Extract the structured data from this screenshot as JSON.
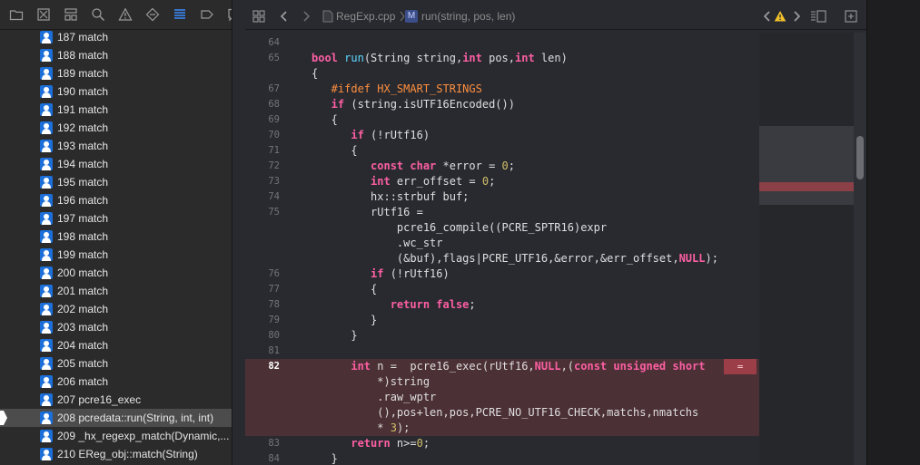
{
  "navigator": {
    "toolbar_icons": [
      "folder-icon",
      "source-control-icon",
      "hierarchy-icon",
      "search-icon",
      "warning-icon",
      "breakpoint-icon",
      "debug-navigator-icon",
      "tag-icon",
      "report-icon"
    ],
    "frames": [
      {
        "label": "187 match",
        "selected": false
      },
      {
        "label": "188 match",
        "selected": false
      },
      {
        "label": "189 match",
        "selected": false
      },
      {
        "label": "190 match",
        "selected": false
      },
      {
        "label": "191 match",
        "selected": false
      },
      {
        "label": "192 match",
        "selected": false
      },
      {
        "label": "193 match",
        "selected": false
      },
      {
        "label": "194 match",
        "selected": false
      },
      {
        "label": "195 match",
        "selected": false
      },
      {
        "label": "196 match",
        "selected": false
      },
      {
        "label": "197 match",
        "selected": false
      },
      {
        "label": "198 match",
        "selected": false
      },
      {
        "label": "199 match",
        "selected": false
      },
      {
        "label": "200 match",
        "selected": false
      },
      {
        "label": "201 match",
        "selected": false
      },
      {
        "label": "202 match",
        "selected": false
      },
      {
        "label": "203 match",
        "selected": false
      },
      {
        "label": "204 match",
        "selected": false
      },
      {
        "label": "205 match",
        "selected": false
      },
      {
        "label": "206 match",
        "selected": false
      },
      {
        "label": "207 pcre16_exec",
        "selected": false
      },
      {
        "label": "208 pcredata::run(String, int, int)",
        "selected": true
      },
      {
        "label": "209 _hx_regexp_match(Dynamic,...",
        "selected": false
      },
      {
        "label": "210 EReg_obj::match(String)",
        "selected": false
      }
    ]
  },
  "jumpbar": {
    "file": "RegExp.cpp",
    "method_badge": "M",
    "method": "run(string, pos, len)"
  },
  "editor": {
    "current_line": "82",
    "error_badge": "=",
    "lines": [
      {
        "n": "64",
        "t": []
      },
      {
        "n": "65",
        "t": [
          [
            "kw",
            "bool "
          ],
          [
            "fn",
            "run"
          ],
          [
            "",
            "(String string,"
          ],
          [
            "kw",
            "int"
          ],
          [
            "",
            " pos,"
          ],
          [
            "kw",
            "int"
          ],
          [
            "",
            " len)"
          ]
        ]
      },
      {
        "n": "",
        "t": [
          [
            "",
            "{"
          ]
        ]
      },
      {
        "n": "67",
        "t": [
          [
            "pp",
            "   #ifdef HX_SMART_STRINGS"
          ]
        ]
      },
      {
        "n": "68",
        "t": [
          [
            "kw",
            "   if"
          ],
          [
            "",
            " (string.isUTF16Encoded())"
          ]
        ]
      },
      {
        "n": "69",
        "t": [
          [
            "",
            "   {"
          ]
        ]
      },
      {
        "n": "70",
        "t": [
          [
            "kw",
            "      if"
          ],
          [
            "",
            " (!rUtf16)"
          ]
        ]
      },
      {
        "n": "71",
        "t": [
          [
            "",
            "      {"
          ]
        ]
      },
      {
        "n": "72",
        "t": [
          [
            "kw",
            "         const char"
          ],
          [
            "",
            " *error = "
          ],
          [
            "num",
            "0"
          ],
          [
            "",
            ";"
          ]
        ]
      },
      {
        "n": "73",
        "t": [
          [
            "kw",
            "         int"
          ],
          [
            "",
            " err_offset = "
          ],
          [
            "num",
            "0"
          ],
          [
            "",
            ";"
          ]
        ]
      },
      {
        "n": "74",
        "t": [
          [
            "",
            "         hx::strbuf buf;"
          ]
        ]
      },
      {
        "n": "75",
        "t": [
          [
            "",
            "         rUtf16 ="
          ]
        ]
      },
      {
        "n": "",
        "t": [
          [
            "",
            "             pcre16_compile((PCRE_SPTR16)expr"
          ]
        ]
      },
      {
        "n": "",
        "t": [
          [
            "",
            "             .wc_str"
          ]
        ]
      },
      {
        "n": "",
        "t": [
          [
            "",
            "             (&buf),flags|PCRE_UTF16,&error,&err_offset,"
          ],
          [
            "kw",
            "NULL"
          ],
          [
            "",
            ");"
          ]
        ]
      },
      {
        "n": "76",
        "t": [
          [
            "kw",
            "         if"
          ],
          [
            "",
            " (!rUtf16)"
          ]
        ]
      },
      {
        "n": "77",
        "t": [
          [
            "",
            "         {"
          ]
        ]
      },
      {
        "n": "78",
        "t": [
          [
            "kw",
            "            return false"
          ],
          [
            "",
            ";"
          ]
        ]
      },
      {
        "n": "79",
        "t": [
          [
            "",
            "         }"
          ]
        ]
      },
      {
        "n": "80",
        "t": [
          [
            "",
            "      }"
          ]
        ]
      },
      {
        "n": "81",
        "t": []
      },
      {
        "n": "82",
        "t": [
          [
            "kw",
            "      int"
          ],
          [
            "",
            " n =  pcre16_exec(rUtf16,"
          ],
          [
            "kw",
            "NULL"
          ],
          [
            "",
            ",("
          ],
          [
            "kw",
            "const unsigned short"
          ]
        ]
      },
      {
        "n": "",
        "t": [
          [
            "",
            "          *)string"
          ]
        ]
      },
      {
        "n": "",
        "t": [
          [
            "",
            "          .raw_wptr"
          ]
        ]
      },
      {
        "n": "",
        "t": [
          [
            "",
            "          (),pos+len,pos,PCRE_NO_UTF16_CHECK,matchs,nmatchs"
          ]
        ]
      },
      {
        "n": "",
        "t": [
          [
            "",
            "          * "
          ],
          [
            "num",
            "3"
          ],
          [
            "",
            ");"
          ]
        ]
      },
      {
        "n": "83",
        "t": [
          [
            "kw",
            "      return"
          ],
          [
            "",
            " n>="
          ],
          [
            "num",
            "0"
          ],
          [
            "",
            ";"
          ]
        ]
      },
      {
        "n": "84",
        "t": [
          [
            "",
            "   }"
          ]
        ]
      }
    ]
  },
  "colors": {
    "accent": "#1c6fd8",
    "keyword": "#fc5fa3",
    "preprocessor": "#fd8f3f",
    "function": "#5dd8ff",
    "number": "#d0bf69",
    "error_line": "#4b3035"
  }
}
